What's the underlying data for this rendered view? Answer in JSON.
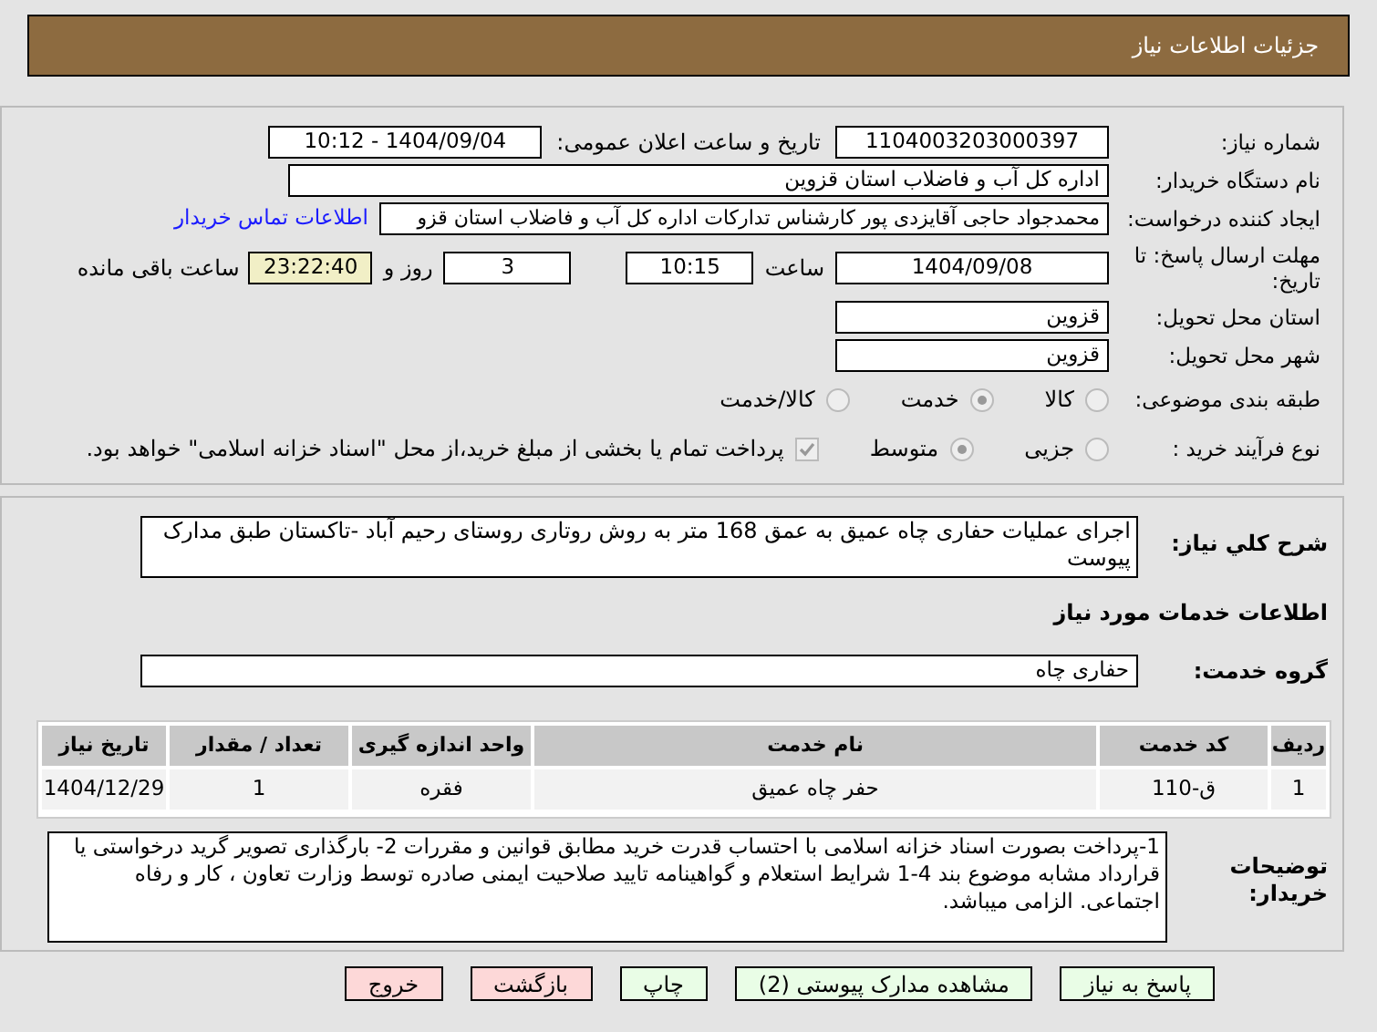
{
  "header": {
    "title": "جزئیات اطلاعات نیاز"
  },
  "need_number": {
    "label": "شماره نیاز:",
    "value": "1104003203000397"
  },
  "announce": {
    "label": "تاریخ و ساعت اعلان عمومی:",
    "value": "1404/09/04 - 10:12"
  },
  "buyer": {
    "label": "نام دستگاه خریدار:",
    "value": "اداره کل آب و فاضلاب استان قزوین"
  },
  "creator": {
    "label": "ایجاد کننده درخواست:",
    "value": "محمدجواد حاجی آقایزدی پور کارشناس تدارکات اداره کل آب و فاضلاب استان قزو",
    "link": "اطلاعات تماس خریدار"
  },
  "deadline": {
    "label": "مهلت ارسال پاسخ: تا تاریخ:",
    "date": "1404/09/08",
    "time_label": "ساعت",
    "time": "10:15",
    "days": "3",
    "days_label": "روز و",
    "remaining": "23:22:40",
    "remaining_label": "ساعت باقی مانده"
  },
  "province": {
    "label": "استان محل تحویل:",
    "value": "قزوین"
  },
  "city": {
    "label": "شهر محل تحویل:",
    "value": "قزوین"
  },
  "category": {
    "label": "طبقه بندی موضوعی:",
    "options": [
      {
        "label": "کالا",
        "selected": false
      },
      {
        "label": "خدمت",
        "selected": true
      },
      {
        "label": "کالا/خدمت",
        "selected": false
      }
    ]
  },
  "process": {
    "label": "نوع فرآیند خرید :",
    "options": [
      {
        "label": "جزیی",
        "selected": false
      },
      {
        "label": "متوسط",
        "selected": true
      }
    ],
    "payment": {
      "checked": true,
      "text": "پرداخت تمام یا بخشی از مبلغ خرید،از محل \"اسناد خزانه اسلامی\" خواهد بود."
    }
  },
  "description": {
    "label": "شرح کلي نیاز:",
    "value": "اجرای عملیات حفاری چاه عمیق به عمق 168 متر  به روش روتاری روستای رحیم آباد -تاکستان طبق مدارک پیوست"
  },
  "services_heading": "اطلاعات خدمات مورد نیاز",
  "service_group": {
    "label": "گروه خدمت:",
    "value": "حفاری چاه"
  },
  "table": {
    "columns": [
      "ردیف",
      "کد خدمت",
      "نام خدمت",
      "واحد اندازه گیری",
      "تعداد / مقدار",
      "تاریخ نیاز"
    ],
    "rows": [
      [
        "1",
        "ق-110",
        "حفر چاه عمیق",
        "فقره",
        "1",
        "1404/12/29"
      ]
    ]
  },
  "buyer_notes": {
    "label": "توضیحات خریدار:",
    "value": "1-پرداخت بصورت اسناد خزانه اسلامی با احتساب قدرت خرید مطابق قوانین و مقررات 2- بارگذاری تصویر گرید درخواستی یا قرارداد مشابه موضوع بند 4-1 شرایط استعلام و گواهینامه تایید صلاحیت ایمنی صادره توسط وزارت تعاون ، کار و رفاه اجتماعی. الزامی میباشد."
  },
  "buttons": [
    {
      "label": "پاسخ به نیاز",
      "kind": "primary"
    },
    {
      "label": "مشاهده مدارک پیوستی (2)",
      "kind": "primary"
    },
    {
      "label": "چاپ",
      "kind": "primary"
    },
    {
      "label": "بازگشت",
      "kind": "danger"
    },
    {
      "label": "خروج",
      "kind": "danger"
    }
  ]
}
